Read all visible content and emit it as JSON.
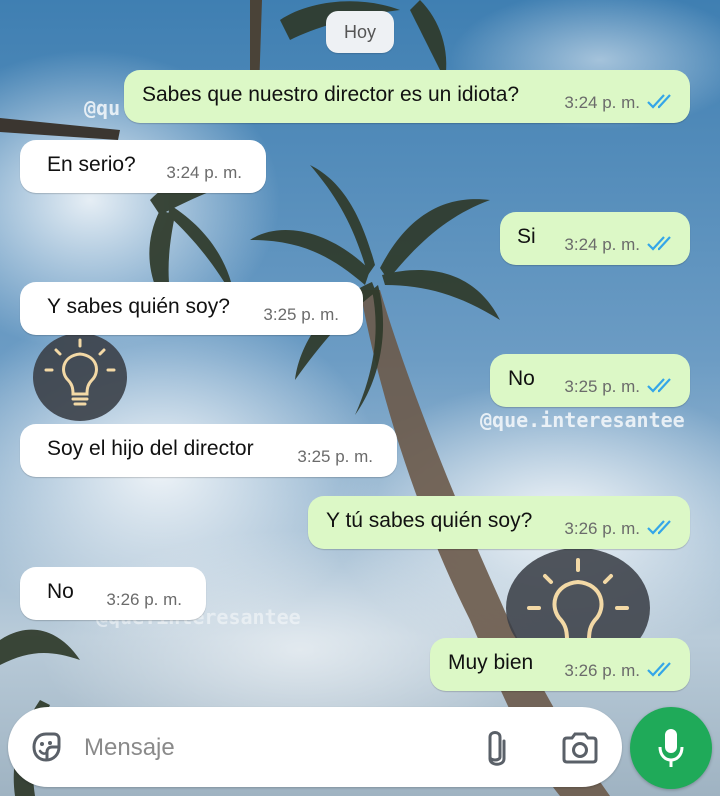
{
  "day_label": "Hoy",
  "messages": [
    {
      "dir": "out",
      "text": "Sabes que nuestro director es un idiota?",
      "time": "3:24 p. m.",
      "read": true
    },
    {
      "dir": "in",
      "text": "En serio?",
      "time": "3:24 p. m."
    },
    {
      "dir": "out",
      "text": "Si",
      "time": "3:24 p. m.",
      "read": true
    },
    {
      "dir": "in",
      "text": "Y sabes quién soy?",
      "time": "3:25 p. m."
    },
    {
      "dir": "out",
      "text": "No",
      "time": "3:25 p. m.",
      "read": true
    },
    {
      "dir": "in",
      "text": "Soy el hijo del director",
      "time": "3:25 p. m."
    },
    {
      "dir": "out",
      "text": "Y tú sabes quién soy?",
      "time": "3:26 p. m.",
      "read": true
    },
    {
      "dir": "in",
      "text": "No",
      "time": "3:26 p. m."
    },
    {
      "dir": "out",
      "text": "Muy bien",
      "time": "3:26 p. m.",
      "read": true
    }
  ],
  "watermarks": {
    "top": "@qu",
    "middle": "@que.interesantee",
    "bottom": "@que.interesantee"
  },
  "composer": {
    "placeholder": "Mensaje",
    "emoji_icon": "sticker-icon",
    "attach_icon": "paperclip-icon",
    "camera_icon": "camera-icon",
    "mic_icon": "microphone-icon"
  },
  "colors": {
    "outgoing_bubble": "#dcf8c6",
    "incoming_bubble": "#ffffff",
    "read_ticks": "#34a6e8",
    "mic_button": "#1faa59"
  }
}
